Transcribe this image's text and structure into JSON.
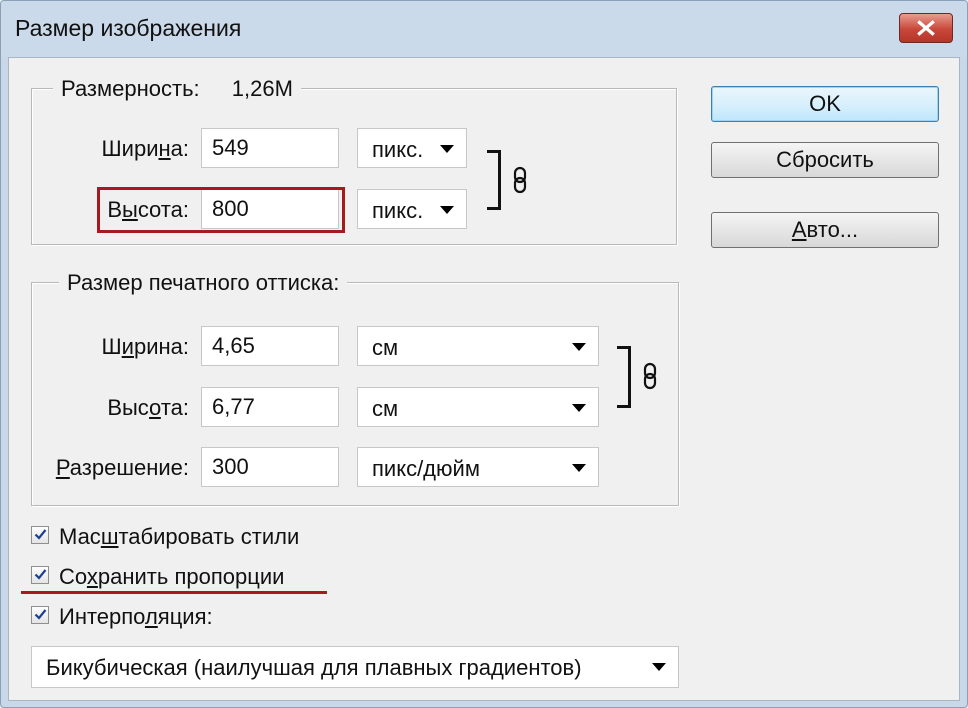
{
  "dialog": {
    "title": "Размер изображения"
  },
  "pixel_dimensions": {
    "legend_label": "Размерность:",
    "legend_value": "1,26M",
    "width": {
      "label_pre": "Шири",
      "label_ul": "н",
      "label_post": "а:",
      "value": "549",
      "unit": "пикс."
    },
    "height": {
      "label_pre": "В",
      "label_ul": "ы",
      "label_post": "сота:",
      "value": "800",
      "unit": "пикс."
    }
  },
  "document_size": {
    "legend": "Размер печатного оттиска:",
    "width": {
      "label_pre": "Ш",
      "label_ul": "и",
      "label_post": "рина:",
      "value": "4,65",
      "unit": "см"
    },
    "height": {
      "label_pre": "Выс",
      "label_ul": "о",
      "label_post": "та:",
      "value": "6,77",
      "unit": "см"
    },
    "resolution": {
      "label_pre": "",
      "label_ul": "Р",
      "label_post": "азрешение:",
      "value": "300",
      "unit": "пикс/дюйм"
    }
  },
  "buttons": {
    "ok": "OK",
    "reset": "Сбросить",
    "auto_pre": "",
    "auto_ul": "А",
    "auto_post": "вто..."
  },
  "options": {
    "scale_styles": {
      "pre": "Мас",
      "ul": "ш",
      "post": "табировать стили",
      "checked": true
    },
    "constrain": {
      "pre": "Со",
      "ul": "х",
      "post": "ранить пропорции",
      "checked": true
    },
    "resample": {
      "pre": "Интерпо",
      "ul": "л",
      "post": "яция:",
      "checked": true
    },
    "resample_method": "Бикубическая (наилучшая для плавных градиентов)"
  },
  "colors": {
    "highlight": "#a6191f",
    "titlebar": "#cbdaea",
    "close_button": "#c8473a",
    "default_button_border": "#3c7fb1"
  }
}
